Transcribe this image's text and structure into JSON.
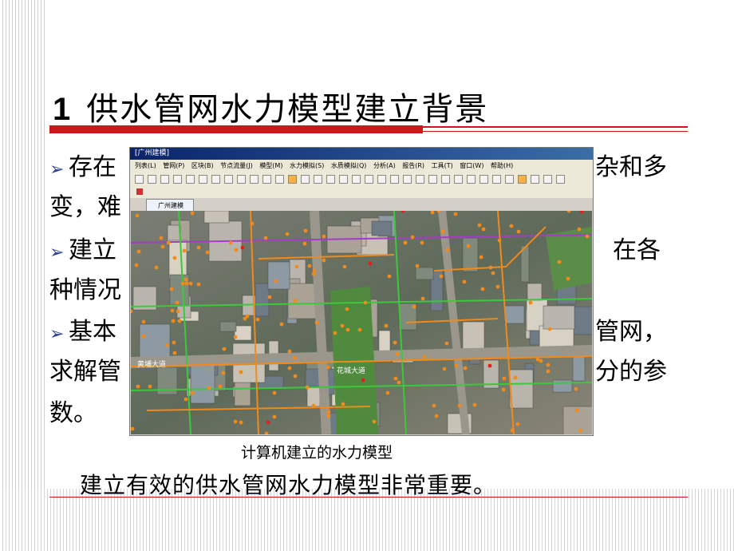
{
  "slide": {
    "title_number": "1",
    "title_text": "供水管网水力模型建立背景",
    "bullets": [
      {
        "left": "存在",
        "right": "杂和多"
      },
      {
        "left": "变，难",
        "right": ""
      },
      {
        "left": "建立",
        "right": "在各"
      },
      {
        "left": "种情况",
        "right": ""
      },
      {
        "left": "基本",
        "right": "管网，"
      },
      {
        "left": "求解管",
        "right": "分的参"
      },
      {
        "left": "数。",
        "right": ""
      }
    ],
    "caption": "计算机建立的水力模型",
    "conclusion": "建立有效的供水管网水力模型非常重要。"
  },
  "app": {
    "title": "[广州建模]",
    "menu": [
      "列表(L)",
      "管网(P)",
      "区块(B)",
      "节点流量(J)",
      "模型(M)",
      "水力模拟(S)",
      "水质模拟(Q)",
      "分析(A)",
      "报告(R)",
      "工具(T)",
      "窗口(W)",
      "帮助(H)"
    ],
    "document_tab": "广州建模",
    "street_labels": [
      "花城大道",
      "黄埔大道"
    ]
  },
  "colors": {
    "accent_red": "#d0151b",
    "bullet_arrow": "#2a3f9a",
    "pipe_orange": "#f08a1c",
    "pipe_green": "#3cc83c",
    "pipe_purple": "#a43cc8"
  }
}
